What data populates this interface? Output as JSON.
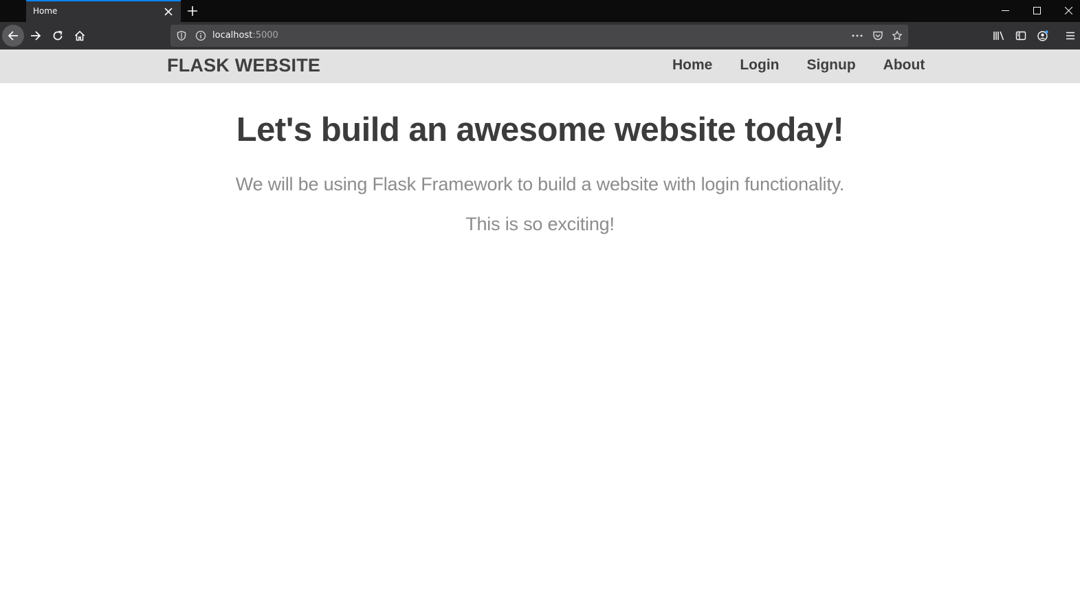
{
  "browser": {
    "tab": {
      "title": "Home"
    },
    "address": {
      "host": "localhost",
      "port": ":5000"
    },
    "icons": {
      "tab_close": "close-icon",
      "new_tab": "plus-icon",
      "back": "arrow-left-icon",
      "forward": "arrow-right-icon",
      "reload": "reload-icon",
      "home": "home-icon",
      "shield": "shield-icon",
      "info": "info-icon",
      "more": "ellipsis-icon",
      "pocket": "pocket-icon",
      "bookmark": "star-icon",
      "library": "library-icon",
      "sidebar": "sidebar-icon",
      "account": "account-icon",
      "menu": "hamburger-icon"
    },
    "colors": {
      "chrome_dark": "#0c0c0d",
      "toolbar": "#323234",
      "urlbar": "#474749",
      "active_tab_accent": "#0a84ff"
    }
  },
  "site": {
    "brand": "FLASK WEBSITE",
    "nav": [
      {
        "label": "Home"
      },
      {
        "label": "Login"
      },
      {
        "label": "Signup"
      },
      {
        "label": "About"
      }
    ],
    "headline": "Let's build an awesome website today!",
    "lead": "We will be using Flask Framework to build a website with login functionality.",
    "sub": "This is so exciting!",
    "colors": {
      "navbar_bg": "#e2e2e2",
      "text_dark": "#3f3f3f",
      "text_muted": "#8c8c8c"
    }
  }
}
